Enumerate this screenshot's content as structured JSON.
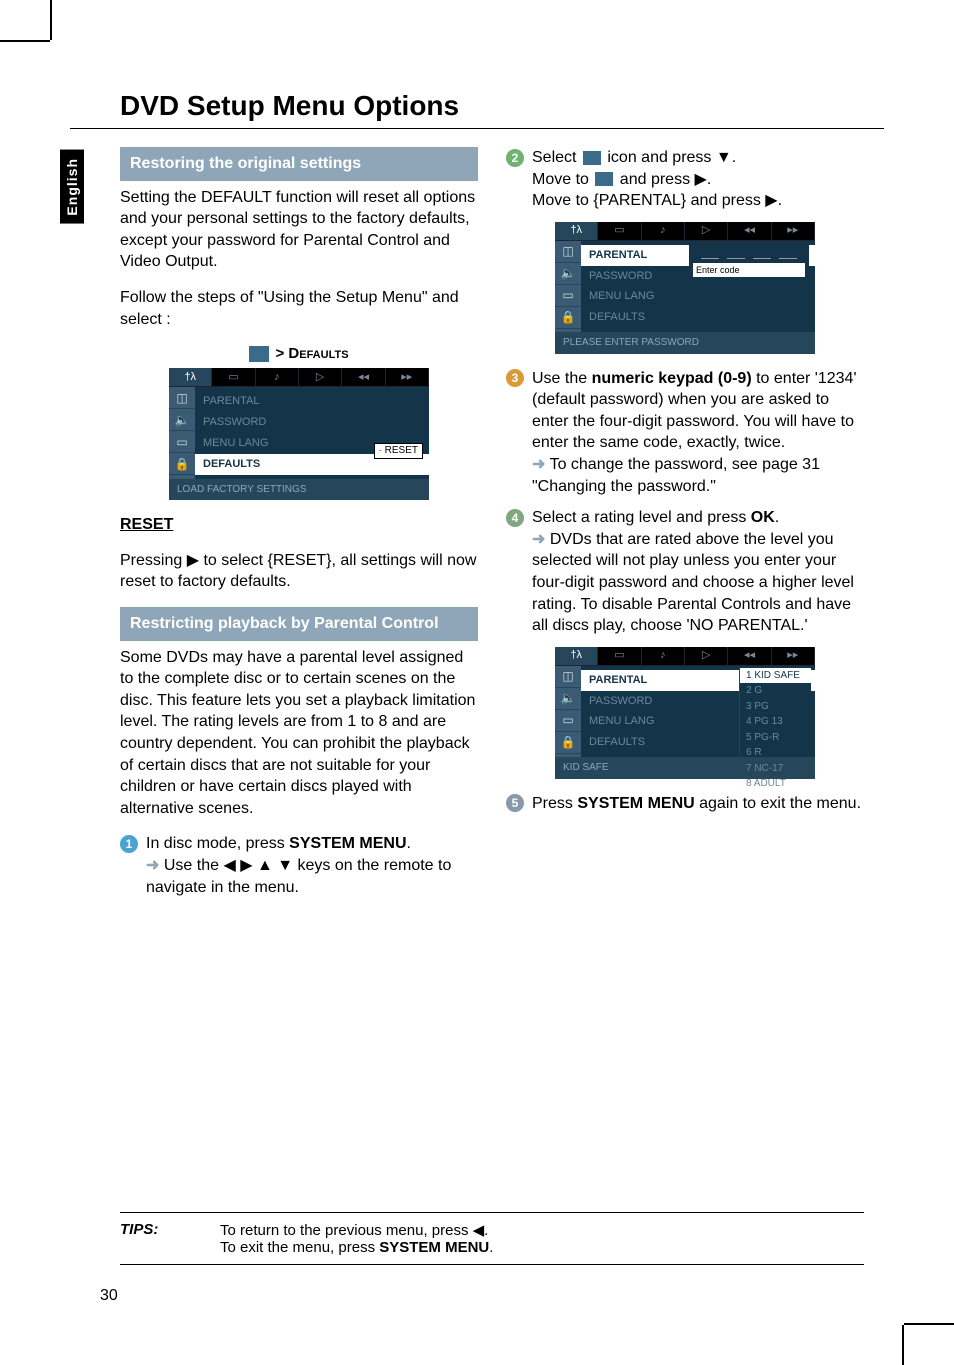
{
  "sideTab": "English",
  "title": "DVD Setup Menu Options",
  "col1": {
    "shade1": "Restoring the original settings",
    "p1": "Setting the DEFAULT function will reset all options and your personal settings to the factory defaults, except your password for Parental Control and Video Output.",
    "p2": "Follow the steps of \"Using the Setup Menu\" and select :",
    "breadcrumb": "> Defaults",
    "osd1": {
      "items": [
        "PARENTAL",
        "PASSWORD",
        "MENU LANG",
        "DEFAULTS"
      ],
      "highlight": "DEFAULTS",
      "popup": "RESET",
      "status": "LOAD FACTORY SETTINGS"
    },
    "resetH": "RESET",
    "resetP": "Pressing ▶ to select {RESET},  all settings will now reset to factory defaults.",
    "shade2": "Restricting playback by Parental Control",
    "p3": "Some DVDs may have a parental level assigned to the complete disc or to certain scenes on the disc.  This feature lets you set a playback limitation level. The rating levels are from 1 to 8 and are country dependent.  You can prohibit the playback of certain discs that are not suitable for your children or have certain discs played with alternative scenes.",
    "step1a": "In disc mode, press ",
    "step1b": "SYSTEM MENU",
    "step1c": ".",
    "step1d": " Use the ◀ ▶ ▲ ▼ keys on the remote to navigate in the menu."
  },
  "col2": {
    "step2a": "Select ",
    "step2b": " icon and press ▼.",
    "step2c": "Move to ",
    "step2d": " and press ▶.",
    "step2e": "Move to {PARENTAL} and press ▶.",
    "osd2": {
      "items": [
        "PARENTAL",
        "PASSWORD",
        "MENU LANG",
        "DEFAULTS"
      ],
      "highlight": "PARENTAL",
      "enter": "Enter code",
      "status": "PLEASE ENTER PASSWORD"
    },
    "step3a": "Use the ",
    "step3b": "numeric keypad (0-9)",
    "step3c": " to enter '1234' (default password) when you are asked to enter the four-digit password. You will have to enter the same code, exactly, twice.",
    "step3d": " To change the password, see page 31 \"Changing the password.\"",
    "step4a": "Select a rating level and press ",
    "step4b": "OK",
    "step4c": ".",
    "step4d": " DVDs that are rated above the level you selected will not play unless you enter your four-digit password and choose a higher level rating.  To disable Parental Controls and have all discs play, choose 'NO PARENTAL.'",
    "osd3": {
      "items": [
        "PARENTAL",
        "PASSWORD",
        "MENU LANG",
        "DEFAULTS"
      ],
      "highlight": "PARENTAL",
      "ratings": [
        "1 KID SAFE",
        "2 G",
        "3 PG",
        "4 PG 13",
        "5 PG-R",
        "6 R",
        "7 NC-17",
        "8 ADULT"
      ],
      "status": "KID SAFE"
    },
    "step5a": "Press ",
    "step5b": "SYSTEM MENU",
    "step5c": " again to exit the menu."
  },
  "tips": {
    "label": "TIPS:",
    "l1a": "To return to the previous menu, press ◀.",
    "l2a": "To exit the menu, press ",
    "l2b": "SYSTEM MENU",
    "l2c": "."
  },
  "pageNum": "30"
}
